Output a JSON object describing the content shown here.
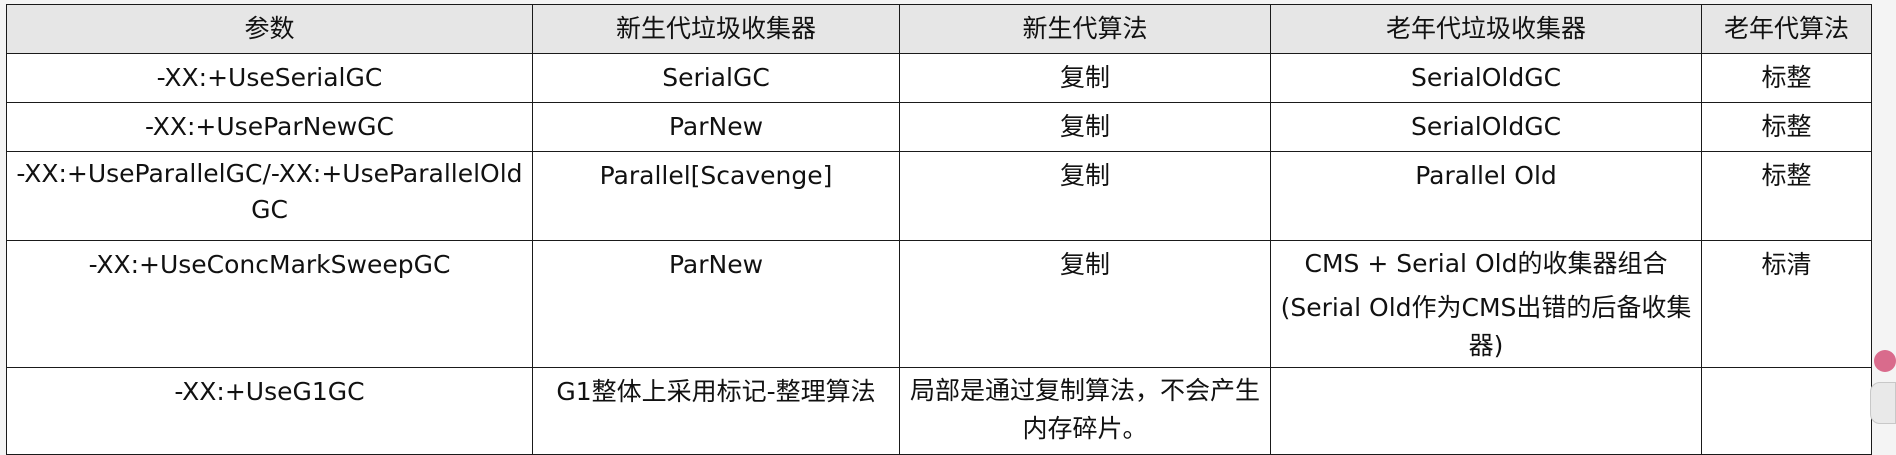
{
  "table": {
    "headers": [
      "参数",
      "新生代垃圾收集器",
      "新生代算法",
      "老年代垃圾收集器",
      "老年代算法"
    ],
    "rows": [
      {
        "param": "-XX:+UseSerialGC",
        "young_gc": "SerialGC",
        "young_algo": "复制",
        "old_gc": "SerialOldGC",
        "old_algo": "标整"
      },
      {
        "param": "-XX:+UseParNewGC",
        "young_gc": "ParNew",
        "young_algo": "复制",
        "old_gc": "SerialOldGC",
        "old_algo": "标整"
      },
      {
        "param": "-XX:+UseParallelGC/-XX:+UseParallelOldGC",
        "young_gc": "Parallel[Scavenge]",
        "young_algo": "复制",
        "old_gc": "Parallel Old",
        "old_algo": "标整"
      },
      {
        "param": "-XX:+UseConcMarkSweepGC",
        "young_gc": "ParNew",
        "young_algo": "复制",
        "old_gc": "CMS + Serial Old的收集器组合",
        "old_gc_note": "(Serial Old作为CMS出错的后备收集器)",
        "old_algo": "标清"
      },
      {
        "param": "-XX:+UseG1GC",
        "young_gc": "G1整体上采用标记-整理算法",
        "young_algo": "局部是通过复制算法，不会产生内存碎片。",
        "old_gc": "",
        "old_algo": ""
      }
    ]
  }
}
